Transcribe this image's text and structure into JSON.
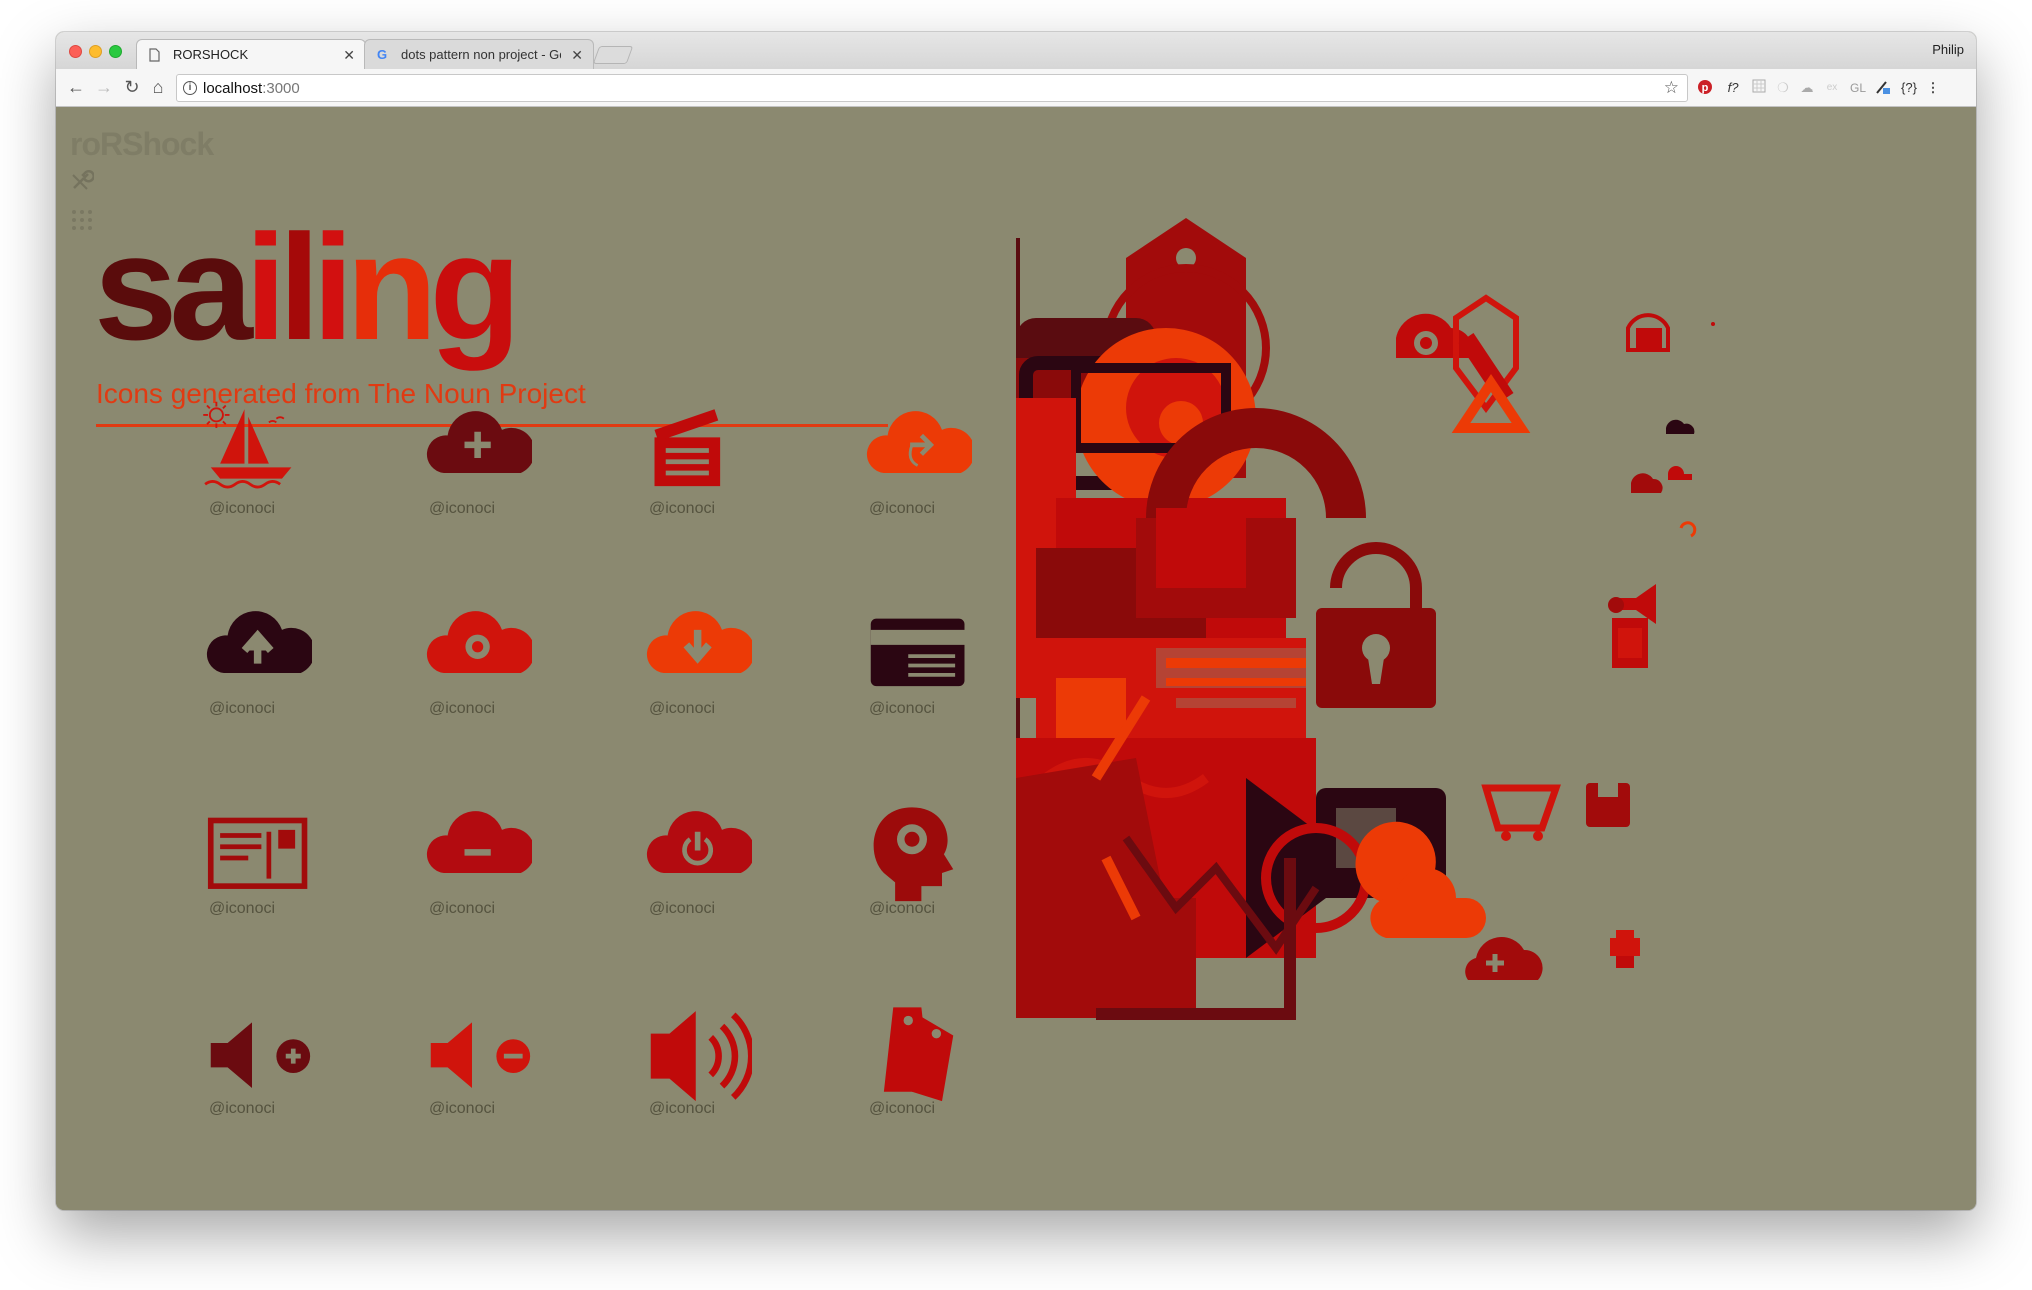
{
  "browser": {
    "tabs": [
      {
        "title": "RORSHOCK",
        "active": true
      },
      {
        "title": "dots pattern non project - Goo",
        "active": false
      }
    ],
    "user": "Philip",
    "url_host": "localhost",
    "url_port": ":3000",
    "extensions": [
      "pinterest-icon",
      "f?",
      "grid-icon",
      "swirl-icon",
      "cloud-icon",
      "ex",
      "GL",
      "pen-icon",
      "{?}",
      "menu-icon"
    ]
  },
  "page": {
    "logo": "roRShock",
    "title_letters": [
      {
        "char": "s",
        "color": "#5a0c0c"
      },
      {
        "char": "a",
        "color": "#5a0c0c"
      },
      {
        "char": "i",
        "color": "#d21010"
      },
      {
        "char": "l",
        "color": "#a50909"
      },
      {
        "char": "i",
        "color": "#d21010"
      },
      {
        "char": "n",
        "color": "#e62e0a"
      },
      {
        "char": "g",
        "color": "#c90d0d"
      }
    ],
    "subtitle": "Icons generated from The Noun Project",
    "icons": [
      {
        "name": "sailboat-icon",
        "credit": "@iconoci",
        "color": "#d0140c"
      },
      {
        "name": "cloud-add-icon",
        "credit": "@iconoci",
        "color": "#6b0b10"
      },
      {
        "name": "clapperboard-icon",
        "credit": "@iconoci",
        "color": "#c00a0a"
      },
      {
        "name": "cloud-share-icon",
        "credit": "@iconoci",
        "color": "#ec3a06"
      },
      {
        "name": "cloud-upload-icon",
        "credit": "@iconoci",
        "color": "#2b0612"
      },
      {
        "name": "cloud-settings-icon",
        "credit": "@iconoci",
        "color": "#d0140c"
      },
      {
        "name": "cloud-download-icon",
        "credit": "@iconoci",
        "color": "#ec3a06"
      },
      {
        "name": "card-reader-icon",
        "credit": "@iconoci",
        "color": "#2b0612"
      },
      {
        "name": "postcard-icon",
        "credit": "@iconoci",
        "color": "#a20b0b"
      },
      {
        "name": "cloud-remove-icon",
        "credit": "@iconoci",
        "color": "#b30b10"
      },
      {
        "name": "cloud-power-icon",
        "credit": "@iconoci",
        "color": "#b30b10"
      },
      {
        "name": "head-gear-icon",
        "credit": "@iconoci",
        "color": "#9c0b0b"
      },
      {
        "name": "volume-plus-icon",
        "credit": "@iconoci",
        "color": "#6b0b10"
      },
      {
        "name": "volume-minus-icon",
        "credit": "@iconoci",
        "color": "#d0140c"
      },
      {
        "name": "volume-loud-icon",
        "credit": "@iconoci",
        "color": "#c00a0a"
      },
      {
        "name": "price-tags-icon",
        "credit": "@iconoci",
        "color": "#c00a0a"
      }
    ]
  }
}
